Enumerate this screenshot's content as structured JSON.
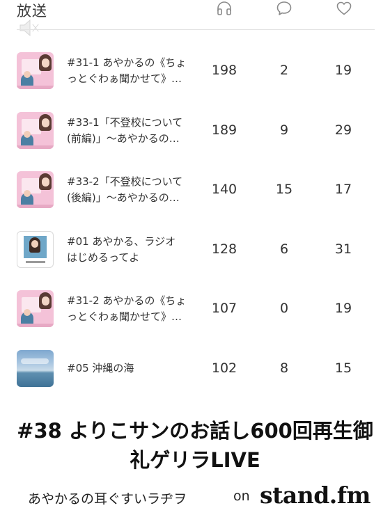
{
  "header": {
    "title": "放送",
    "icons": {
      "plays": "headphones-icon",
      "comments": "speech-bubble-icon",
      "likes": "heart-icon",
      "mute": "speaker-muted-icon"
    }
  },
  "episodes": [
    {
      "title": "#31-1 あやかるの《ちょ\nっとぐわぁ聞かせて》…",
      "plays": "198",
      "comments": "2",
      "likes": "19",
      "thumb": "pink"
    },
    {
      "title": "#33-1「不登校について\n(前編)」〜あやかるの…",
      "plays": "189",
      "comments": "9",
      "likes": "29",
      "thumb": "pink"
    },
    {
      "title": "#33-2「不登校について\n(後編)」〜あやかるの…",
      "plays": "140",
      "comments": "15",
      "likes": "17",
      "thumb": "pink"
    },
    {
      "title": "#01 あやかる、ラジオ\nはじめるってよ",
      "plays": "128",
      "comments": "6",
      "likes": "31",
      "thumb": "white"
    },
    {
      "title": "#31-2 あやかるの《ちょ\nっとぐわぁ聞かせて》…",
      "plays": "107",
      "comments": "0",
      "likes": "19",
      "thumb": "pink"
    },
    {
      "title": "#05 沖縄の海",
      "plays": "102",
      "comments": "8",
      "likes": "15",
      "thumb": "sea"
    }
  ],
  "live": {
    "title": "#38 よりこサンのお話し600回再生御\n礼ゲリラLIVE"
  },
  "channel": {
    "name": "あやかるの耳ぐすいラヂヲ",
    "on": "on",
    "brand": "stand.fm"
  }
}
